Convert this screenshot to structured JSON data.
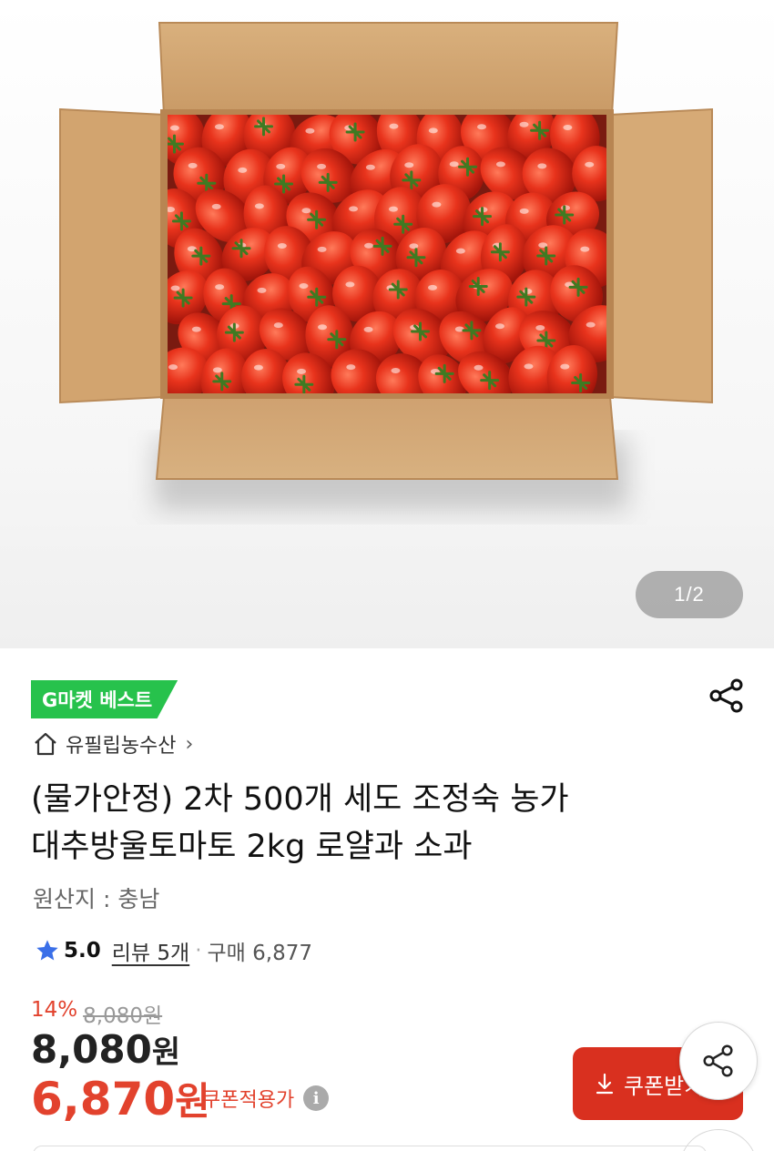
{
  "hero": {
    "pager_current": "1",
    "pager_total": "2",
    "pager_text": "1/2"
  },
  "product": {
    "badge": "G마켓 베스트",
    "store_name": "유필립농수산",
    "title_line1": "(물가안정) 2차 500개 세도 조정숙 농가",
    "title_line2": "대추방울토마토 2kg 로얄과 소과",
    "origin": "원산지 : 충남",
    "rating": "5.0",
    "reviews": "리뷰 5개",
    "purchases": "구매 6,877",
    "discount_percent": "14%",
    "original_price": "8,080원",
    "price_number": "8,080",
    "price_unit": "원",
    "coupon_price_number": "6,870",
    "coupon_price_unit": "원",
    "coupon_label": "쿠폰적용가",
    "coupon_button": "쿠폰받기"
  },
  "icons": {
    "share": "share-icon",
    "home": "home-icon",
    "star": "star-icon",
    "info": "info-icon",
    "download": "download-icon"
  },
  "colors": {
    "badge": "#27c24c",
    "accent_red": "#e2422d",
    "coupon_button": "#d9301f",
    "star": "#3a6fe8"
  }
}
